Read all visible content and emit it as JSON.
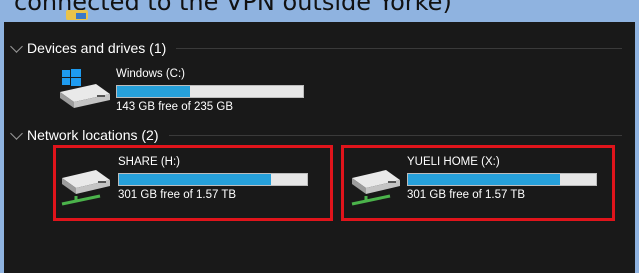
{
  "caption": {
    "text": "connected to the VPN outside Yorke)"
  },
  "groups": {
    "devices": {
      "label": "Devices and drives (1)"
    },
    "network": {
      "label": "Network locations (2)"
    }
  },
  "drives": [
    {
      "label": "Windows (C:)",
      "free_text": "143 GB free of 235 GB",
      "used_fraction": 0.39
    },
    {
      "label": "SHARE (H:)",
      "free_text": "301 GB free of 1.57 TB",
      "used_fraction": 0.81
    },
    {
      "label": "YUELI HOME (X:)",
      "free_text": "301 GB free of 1.57 TB",
      "used_fraction": 0.81
    }
  ],
  "colors": {
    "bar_fill": "#26a0da",
    "highlight": "#e0141b",
    "background": "#191919"
  }
}
